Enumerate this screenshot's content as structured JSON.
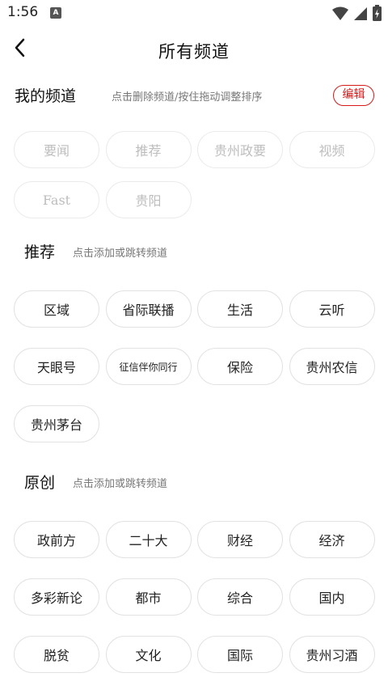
{
  "status_bar": {
    "time": "1:56",
    "notification_glyph": "A",
    "icons": [
      "wifi-icon",
      "signal-icon",
      "battery-icon"
    ]
  },
  "header": {
    "back_icon": "back-arrow-icon",
    "title": "所有频道"
  },
  "my_channels": {
    "title": "我的频道",
    "hint": "点击删除频道/按住拖动调整排序",
    "edit_label": "编辑",
    "items": [
      {
        "label": "要闻"
      },
      {
        "label": "推荐"
      },
      {
        "label": "贵州政要"
      },
      {
        "label": "视频"
      },
      {
        "label": "Fast"
      },
      {
        "label": "贵阳"
      }
    ]
  },
  "recommend": {
    "title": "推荐",
    "hint": "点击添加或跳转频道",
    "items": [
      {
        "label": "区域"
      },
      {
        "label": "省际联播"
      },
      {
        "label": "生活"
      },
      {
        "label": "云听"
      },
      {
        "label": "天眼号"
      },
      {
        "label": "征信伴你同行"
      },
      {
        "label": "保险"
      },
      {
        "label": "贵州农信"
      },
      {
        "label": "贵州茅台"
      }
    ]
  },
  "original": {
    "title": "原创",
    "hint": "点击添加或跳转频道",
    "items": [
      {
        "label": "政前方"
      },
      {
        "label": "二十大"
      },
      {
        "label": "财经"
      },
      {
        "label": "经济"
      },
      {
        "label": "多彩新论"
      },
      {
        "label": "都市"
      },
      {
        "label": "综合"
      },
      {
        "label": "国内"
      },
      {
        "label": "脱贫"
      },
      {
        "label": "文化"
      },
      {
        "label": "国际"
      },
      {
        "label": "贵州习酒"
      }
    ]
  },
  "colors": {
    "accent": "#d61a1a",
    "disabled_text": "#bdbdbd",
    "chip_border": "#e2e2e2"
  }
}
